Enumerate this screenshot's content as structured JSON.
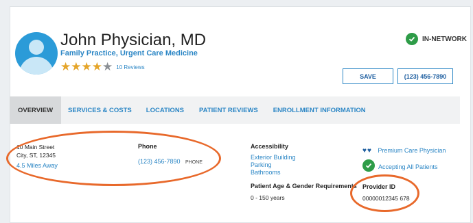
{
  "provider": {
    "name": "John Physician, MD",
    "specialty": "Family Practice, Urgent Care Medicine",
    "rating": 4,
    "rating_max": 5,
    "reviews": "10 Reviews",
    "network_status": "IN-NETWORK"
  },
  "actions": {
    "save_label": "SAVE",
    "phone_label": "(123) 456-7890"
  },
  "tabs": [
    {
      "label": "OVERVIEW",
      "active": true
    },
    {
      "label": "SERVICES & COSTS",
      "active": false
    },
    {
      "label": "LOCATIONS",
      "active": false
    },
    {
      "label": "PATIENT REVIEWS",
      "active": false
    },
    {
      "label": "ENROLLMENT INFORMATION",
      "active": false
    }
  ],
  "address": {
    "street": "10 Main Street",
    "city": "City, ST, 12345",
    "distance": "4.5 Miles Away"
  },
  "phone": {
    "heading": "Phone",
    "number": "(123) 456-7890",
    "type": "PHONE"
  },
  "accessibility": {
    "heading": "Accessibility",
    "items": [
      "Exterior Building",
      "Parking",
      "Bathrooms"
    ]
  },
  "requirements": {
    "heading": "Patient Age & Gender Requirements",
    "value": "0 - 150  years"
  },
  "badges": {
    "premium": "Premium Care Physician",
    "accepting": "Accepting All Patients"
  },
  "provider_id": {
    "heading": "Provider ID",
    "value": "00000012345  678"
  },
  "colors": {
    "accent": "#2b86c5",
    "star": "#e5a52a",
    "star_empty": "#8b8f94",
    "check": "#2e9c48",
    "annotation": "#e8692b"
  }
}
